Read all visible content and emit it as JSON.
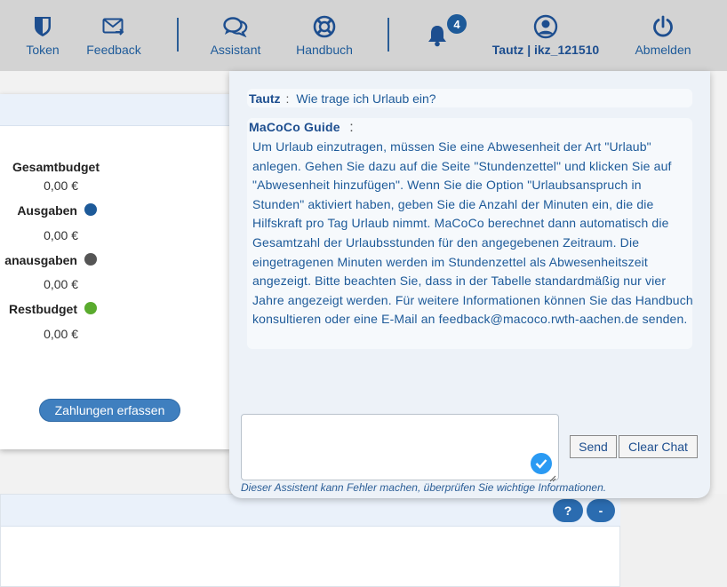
{
  "nav": {
    "token_label": "Token",
    "feedback_label": "Feedback",
    "assistant_label": "Assistant",
    "handbook_label": "Handbuch",
    "notification_count": "4",
    "user_label": "Tautz | ikz_121510",
    "logout_label": "Abmelden",
    "icons": [
      "shield-icon",
      "mail-arrow-icon",
      "chat-bubbles-icon",
      "lifebuoy-icon",
      "bell-icon",
      "user-circle-icon",
      "power-icon"
    ]
  },
  "budget": {
    "rows": [
      {
        "label": "Gesamtbudget",
        "value": "0,00 €",
        "color": null
      },
      {
        "label": "Ausgaben",
        "value": "0,00 €",
        "color": "#1d5a99"
      },
      {
        "label": "anausgaben",
        "value": "0,00 €",
        "color": "#555555"
      },
      {
        "label": "Restbudget",
        "value": "0,00 €",
        "color": "#5aab2e"
      }
    ],
    "pay_button": "Zahlungen erfassen"
  },
  "lower_card": {
    "help_button": "?",
    "collapse_button": "-"
  },
  "chat": {
    "user_sender": "Tautz",
    "user_message": "Wie trage ich Urlaub ein?",
    "bot_sender": "MaCoCo Guide",
    "separator": ":",
    "bot_message": "Um Urlaub einzutragen, müssen Sie eine Abwesenheit der Art \"Urlaub\" anlegen. Gehen Sie dazu auf die Seite \"Stundenzettel\" und klicken Sie auf \"Abwesenheit hinzufügen\". Wenn Sie die Option \"Urlaubsanspruch in Stunden\" aktiviert haben, geben Sie die Anzahl der Minuten ein, die die Hilfskraft pro Tag Urlaub nimmt. MaCoCo berechnet dann automatisch die Gesamtzahl der Urlaubsstunden für den angegebenen Zeitraum. Die eingetragenen Minuten werden im Stundenzettel als Abwesenheitszeit angezeigt. Bitte beachten Sie, dass in der Tabelle standardmäßig nur vier Jahre angezeigt werden. Für weitere Informationen können Sie das Handbuch konsultieren oder eine E-Mail an feedback@macoco.rwth-aachen.de senden.",
    "input_value": "",
    "send_label": "Send",
    "clear_label": "Clear Chat",
    "disclaimer": "Dieser Assistent kann Fehler machen, überprüfen Sie wichtige Informationen."
  }
}
